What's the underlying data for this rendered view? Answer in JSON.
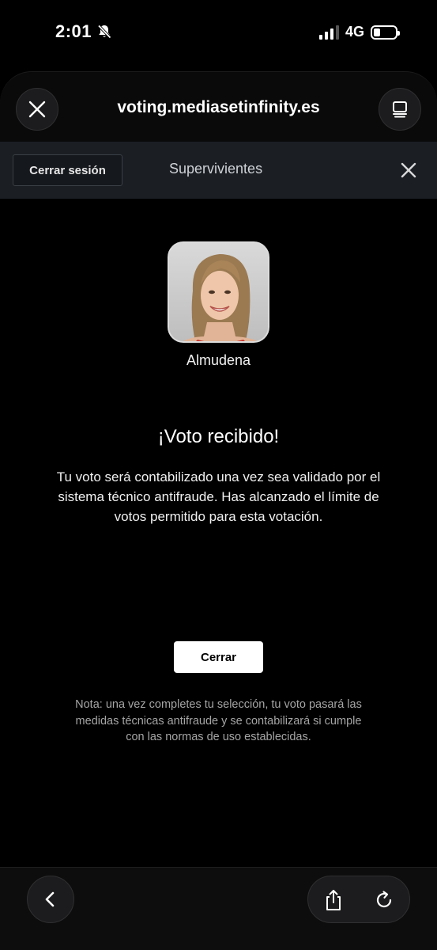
{
  "status_bar": {
    "time": "2:01",
    "network": "4G",
    "silent_icon": "bell-slash-icon",
    "signal_bars_active": 3,
    "signal_bars_total": 4,
    "battery_level": 0.3
  },
  "browser": {
    "url": "voting.mediasetinfinity.es",
    "close_icon": "close-icon",
    "tabs_icon": "tabs-icon"
  },
  "site_nav": {
    "logout_label": "Cerrar sesión",
    "section_title": "Supervivientes",
    "close_icon": "close-icon"
  },
  "contestant": {
    "name": "Almudena"
  },
  "confirmation": {
    "title": "¡Voto recibido!",
    "message": "Tu voto será contabilizado una vez sea validado por el sistema técnico antifraude. Has alcanzado el límite de votos permitido para esta votación.",
    "close_label": "Cerrar",
    "note": "Nota: una vez completes tu selección, tu voto pasará las medidas técnicas antifraude y se contabilizará si cumple con las normas de uso establecidas."
  },
  "toolbar": {
    "back_icon": "chevron-left-icon",
    "share_icon": "share-icon",
    "reload_icon": "reload-icon"
  }
}
